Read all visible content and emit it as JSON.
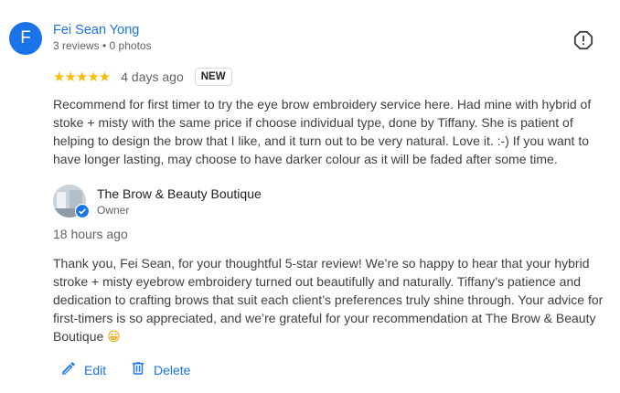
{
  "review": {
    "avatar_letter": "F",
    "reviewer_name": "Fei Sean Yong",
    "reviewer_meta": "3 reviews • 0 photos",
    "stars": "★★★★★",
    "rating": 5,
    "date": "4 days ago",
    "badge": "NEW",
    "text": "Recommend for first timer to try the eye brow embroidery service here. Had mine with hybrid of stoke + misty with the same price if choose individual type, done by Tiffany. She is patient of helping to design the brow that I like, and it turn out to be very natural. Love it. :-) If you want to have longer lasting, may choose to have darker colour as it will be faded after some time."
  },
  "owner_reply": {
    "name": "The Brow & Beauty Boutique",
    "role": "Owner",
    "date": "18 hours ago",
    "text": "Thank you, Fei Sean, for your thoughtful 5-star review! We’re so happy to hear that your hybrid stroke + misty eyebrow embroidery turned out beautifully and naturally. Tiffany’s patience and dedication to crafting brows that suit each client’s preferences truly shine through. Your advice for first-timers is so appreciated, and we’re grateful for your recommendation at The Brow & Beauty Boutique",
    "emoji": "😀"
  },
  "actions": {
    "edit_label": "Edit",
    "delete_label": "Delete"
  },
  "colors": {
    "accent": "#1a73e8",
    "star": "#fbbc04"
  },
  "icons": {
    "report": "report-icon",
    "verified": "verified-check-icon",
    "edit": "pencil-icon",
    "delete": "trash-icon"
  }
}
